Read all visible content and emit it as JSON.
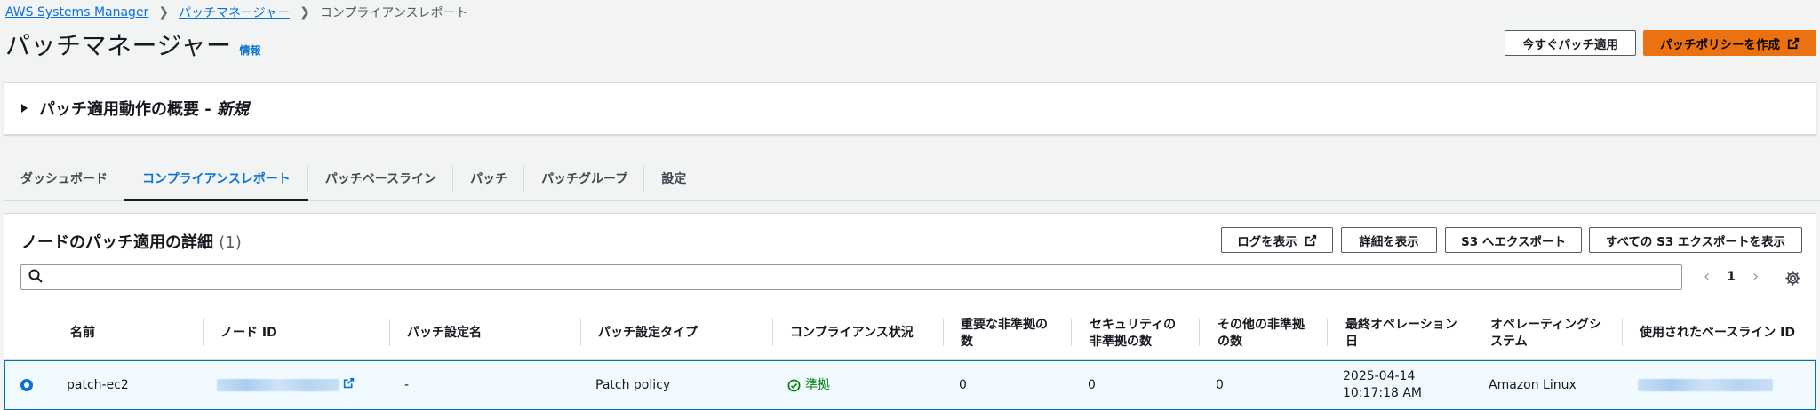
{
  "breadcrumb": {
    "items": [
      "AWS Systems Manager",
      "パッチマネージャー"
    ],
    "current": "コンプライアンスレポート"
  },
  "page": {
    "title": "パッチマネージャー",
    "info": "情報"
  },
  "header_buttons": {
    "patch_now": "今すぐパッチ適用",
    "create_policy": "パッチポリシーを作成"
  },
  "overview": {
    "title": "パッチ適用動作の概要 - ",
    "new": "新規"
  },
  "tabs": [
    "ダッシュボード",
    "コンプライアンスレポート",
    "パッチベースライン",
    "パッチ",
    "パッチグループ",
    "設定"
  ],
  "active_tab": "コンプライアンスレポート",
  "panel": {
    "title": "ノードのパッチ適用の詳細",
    "count": "(1)",
    "buttons": {
      "logs": "ログを表示",
      "details": "詳細を表示",
      "s3_export": "S3 へエクスポート",
      "all_s3": "すべての S3 エクスポートを表示"
    },
    "search_placeholder": "",
    "page": "1"
  },
  "table": {
    "headers": {
      "name": "名前",
      "node_id": "ノード ID",
      "patch_config_name": "パッチ設定名",
      "patch_config_type": "パッチ設定タイプ",
      "compliance": "コンプライアンス状況",
      "critical1": "重要な非準拠の",
      "critical2": "数",
      "security1": "セキュリティの",
      "security2": "非準拠の数",
      "other1": "その他の非準拠",
      "other2": "の数",
      "lastop1": "最終オペレーション",
      "lastop2": "日",
      "os1": "オペレーティングシ",
      "os2": "ステム",
      "baseline": "使用されたベースライン ID"
    },
    "rows": [
      {
        "name": "patch-ec2",
        "patch_config_name": "-",
        "patch_config_type": "Patch policy",
        "compliance": "準拠",
        "critical": "0",
        "security": "0",
        "other": "0",
        "date1": "2025-04-14",
        "date2": "10:17:18 AM",
        "os": "Amazon Linux"
      }
    ]
  },
  "colors": {
    "link": "#0972d3",
    "primary": "#ec7211",
    "compliant": "#037f0c",
    "selected_row": "#f1faff"
  }
}
